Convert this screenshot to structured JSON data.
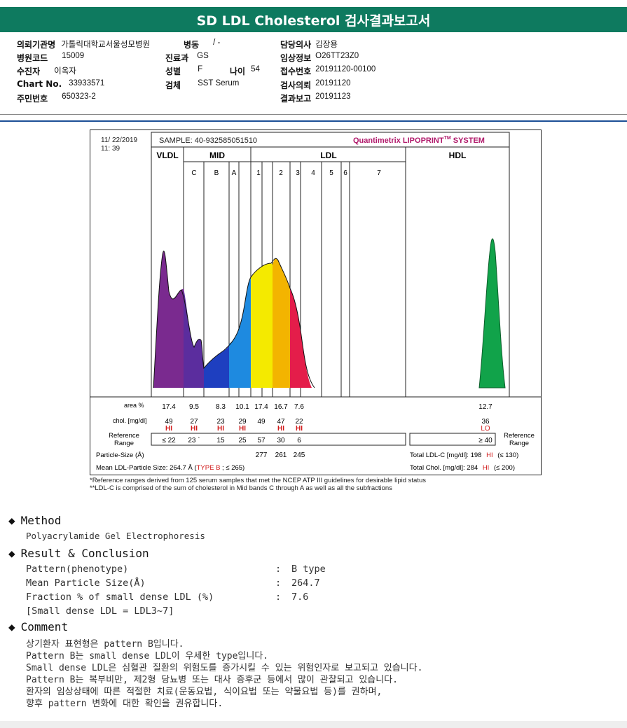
{
  "title": "SD LDL Cholesterol 검사결과보고서",
  "info": {
    "institution_label": "의뢰기관명",
    "institution_value": "가톨릭대학교서울성모병원",
    "ward_label": "병동",
    "ward_value": "/ -",
    "doctor_label": "담당의사",
    "doctor_value": "김장용",
    "hospital_code_label": "병원코드",
    "hospital_code_value": "15009",
    "dept_label": "진료과",
    "dept_value": "GS",
    "clinical_label": "임상정보",
    "clinical_value": "O26TT23Z0",
    "patient_label": "수진자",
    "patient_value": "이옥자",
    "sex_label": "성별",
    "sex_value": "F",
    "age_label": "나이",
    "age_value": "54",
    "receipt_label": "접수번호",
    "receipt_value": "20191120-00100",
    "chart_label": "Chart No.",
    "chart_value": "33933571",
    "specimen_label": "검체",
    "specimen_value": "SST Serum",
    "request_label": "검사의뢰",
    "request_value": "20191120",
    "id_label": "주민번호",
    "id_value": "650323-2",
    "report_label": "결과보고",
    "report_value": "20191123"
  },
  "figure": {
    "datetime_line1": "11/ 22/2019",
    "datetime_line2": "11: 39",
    "sample": "SAMPLE:   40-932585051510",
    "system": "Quantimetrix LIPOPRINT",
    "system_tm": "TM",
    "system_suffix": " SYSTEM",
    "band_vldl": "VLDL",
    "band_mid": "MID",
    "band_ldl": "LDL",
    "band_hdl": "HDL",
    "sub_labels": [
      "C",
      "B",
      "A",
      "1",
      "2",
      "3",
      "4",
      "5",
      "6",
      "7"
    ],
    "row_area_label": "area %",
    "area_values": [
      "17.4",
      "9.5",
      "8.3",
      "10.1",
      "17.4",
      "16.7",
      "7.6"
    ],
    "area_hdl": "12.7",
    "row_chol_label": "chol. [mg/dl]",
    "chol_values": [
      "49",
      "27",
      "23",
      "29",
      "49",
      "47",
      "22"
    ],
    "chol_flags": [
      "HI",
      "HI",
      "HI",
      "HI",
      "",
      "HI",
      "HI"
    ],
    "chol_hdl": "36",
    "chol_hdl_flag": "LO",
    "ref_label_1": "Reference",
    "ref_label_2": "Range",
    "ref_values": [
      "≤ 22",
      "23 `",
      "15",
      "25",
      "57",
      "30",
      "6"
    ],
    "ref_hdl": "≥ 40",
    "particle_label": "Particle-Size (Å)",
    "particle_values": [
      "277",
      "261",
      "245"
    ],
    "mean_label": "Mean LDL-Particle Size:   264.7 Å  (",
    "mean_type": "TYPE B",
    "mean_suffix": " ; ≤ 265)",
    "total_ldl_label": "Total LDL-C [mg/dl]:  198",
    "total_ldl_flag": "HI",
    "total_ldl_range": "(≤ 130)",
    "total_chol_label": "Total Chol. [mg/dl]:   284",
    "total_chol_flag": "HI",
    "total_chol_range": "(≤ 200)"
  },
  "notes": {
    "note1": "*Reference ranges derived from 125 serum samples that met the NCEP ATP III guidelines for desirable lipid status",
    "note2": "**LDL-C is comprised of the sum of cholesterol in Mid bands C through A as well as all the subfractions"
  },
  "method": {
    "heading": "Method",
    "text": "Polyacrylamide Gel Electrophoresis"
  },
  "result": {
    "heading": "Result & Conclusion",
    "pattern_label": "Pattern(phenotype)",
    "pattern_value": "B type",
    "mean_label": "Mean Particle Size(Å)",
    "mean_value": "264.7",
    "fraction_label": "Fraction % of small dense LDL (%)",
    "fraction_value": "7.6",
    "bracket": "[Small dense LDL = LDL3~7]",
    "colon": ":"
  },
  "comment": {
    "heading": "Comment",
    "lines": [
      "상기환자 표현형은 pattern B입니다.",
      "Pattern B는 small dense LDL이 우세한 type입니다.",
      "Small dense LDL은 심혈관 질환의 위험도를 증가시킬 수 있는 위험인자로 보고되고 있습니다.",
      "Pattern B는 복부비만, 제2형 당뇨병 또는 대사 증후군 등에서 많이 관찰되고 있습니다.",
      "환자의 임상상태에 따른 적절한 치료(운동요법, 식이요법 또는 약물요법 등)를 권하며,",
      "향후 pattern 변화에 대한 확인을 권유합니다."
    ]
  },
  "colors": {
    "header": "#0e7a5f",
    "flag": "#d11a1a",
    "vldl": "#7a2a8f",
    "mid_c": "#5b2d9e",
    "mid_b": "#1e3fc0",
    "mid_a": "#1e8ae0",
    "ldl1": "#f4ea00",
    "ldl2": "#f3b400",
    "ldl3": "#e41d4a",
    "hdl": "#11a34a"
  }
}
